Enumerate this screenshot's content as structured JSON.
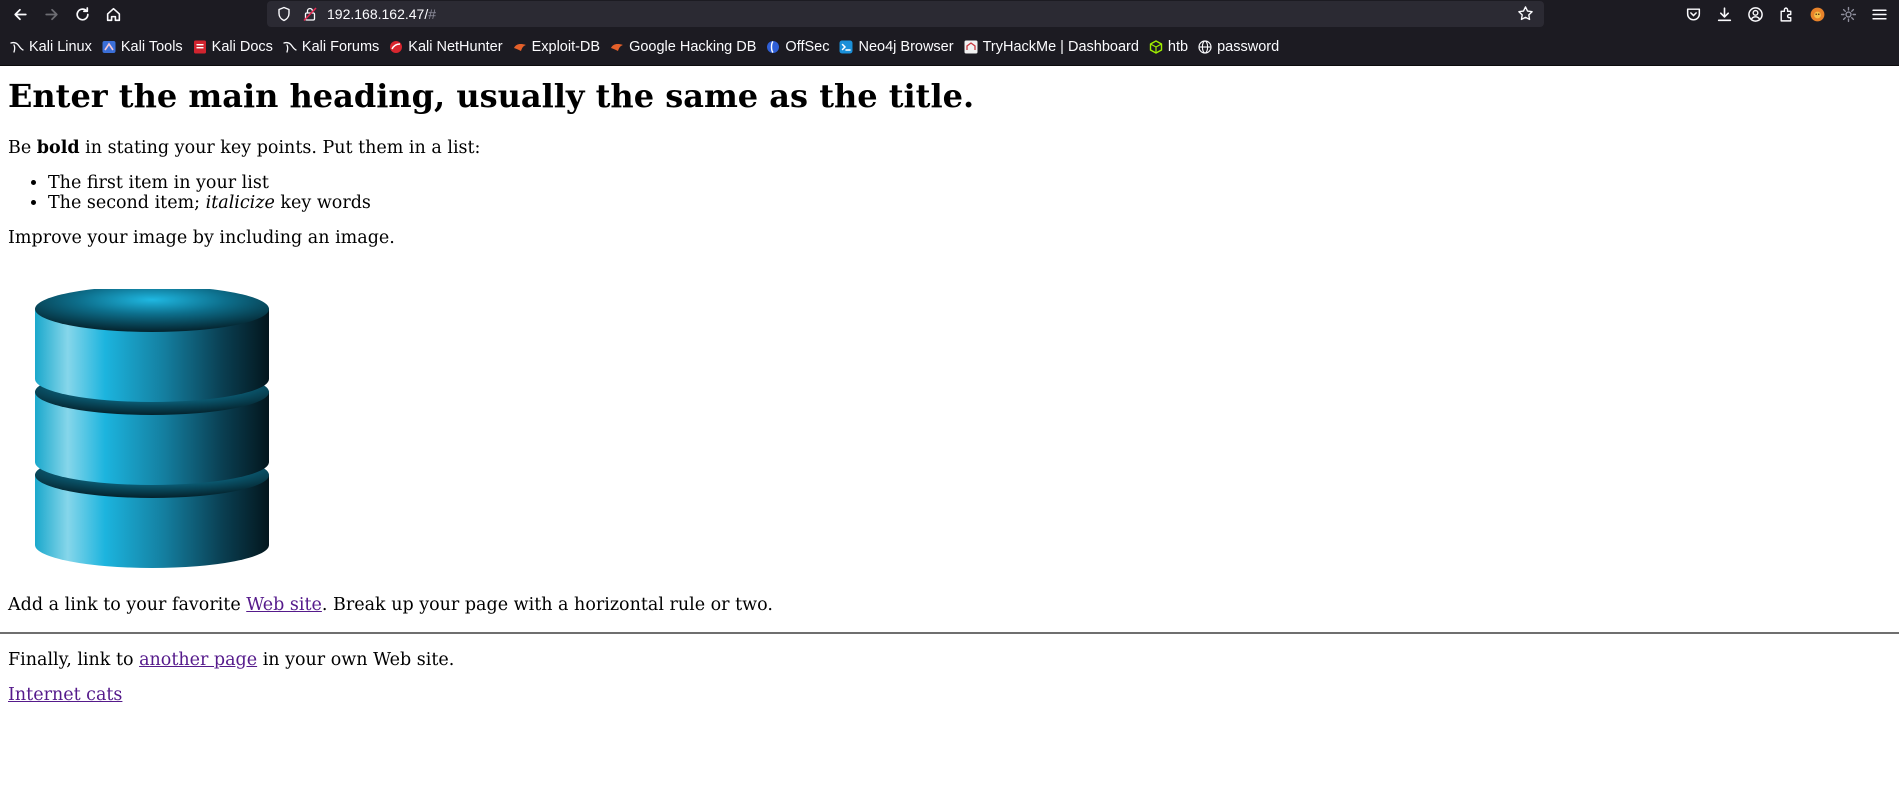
{
  "browser": {
    "url_main": "192.168.162.47/",
    "url_hash": "#",
    "bookmarks": [
      {
        "label": "Kali Linux",
        "icon": "kali-dragon-icon"
      },
      {
        "label": "Kali Tools",
        "icon": "kali-tools-icon"
      },
      {
        "label": "Kali Docs",
        "icon": "kali-docs-icon"
      },
      {
        "label": "Kali Forums",
        "icon": "kali-dragon-icon"
      },
      {
        "label": "Kali NetHunter",
        "icon": "nethunter-icon"
      },
      {
        "label": "Exploit-DB",
        "icon": "exploit-db-icon"
      },
      {
        "label": "Google Hacking DB",
        "icon": "ghdb-icon"
      },
      {
        "label": "OffSec",
        "icon": "offsec-icon"
      },
      {
        "label": "Neo4j Browser",
        "icon": "neo4j-icon"
      },
      {
        "label": "TryHackMe | Dashboard",
        "icon": "tryhackme-icon"
      },
      {
        "label": "htb",
        "icon": "htb-cube-icon"
      },
      {
        "label": "password",
        "icon": "globe-icon"
      }
    ]
  },
  "page": {
    "heading": "Enter the main heading, usually the same as the title.",
    "p1_before": "Be ",
    "p1_bold": "bold",
    "p1_after": " in stating your key points. Put them in a list:",
    "list_item_1": "The first item in your list",
    "list_item_2_before": "The second item; ",
    "list_item_2_italic": "italicize",
    "list_item_2_after": " key words",
    "p2": "Improve your image by including an image.",
    "image_icon": "database-icon",
    "p3_before": "Add a link to your favorite ",
    "p3_link": "Web site",
    "p3_after": ". Break up your page with a horizontal rule or two.",
    "p4_before": "Finally, link to ",
    "p4_link": "another page",
    "p4_after": " in your own Web site.",
    "p5_link": "Internet cats",
    "link_color": "#551a8b"
  }
}
